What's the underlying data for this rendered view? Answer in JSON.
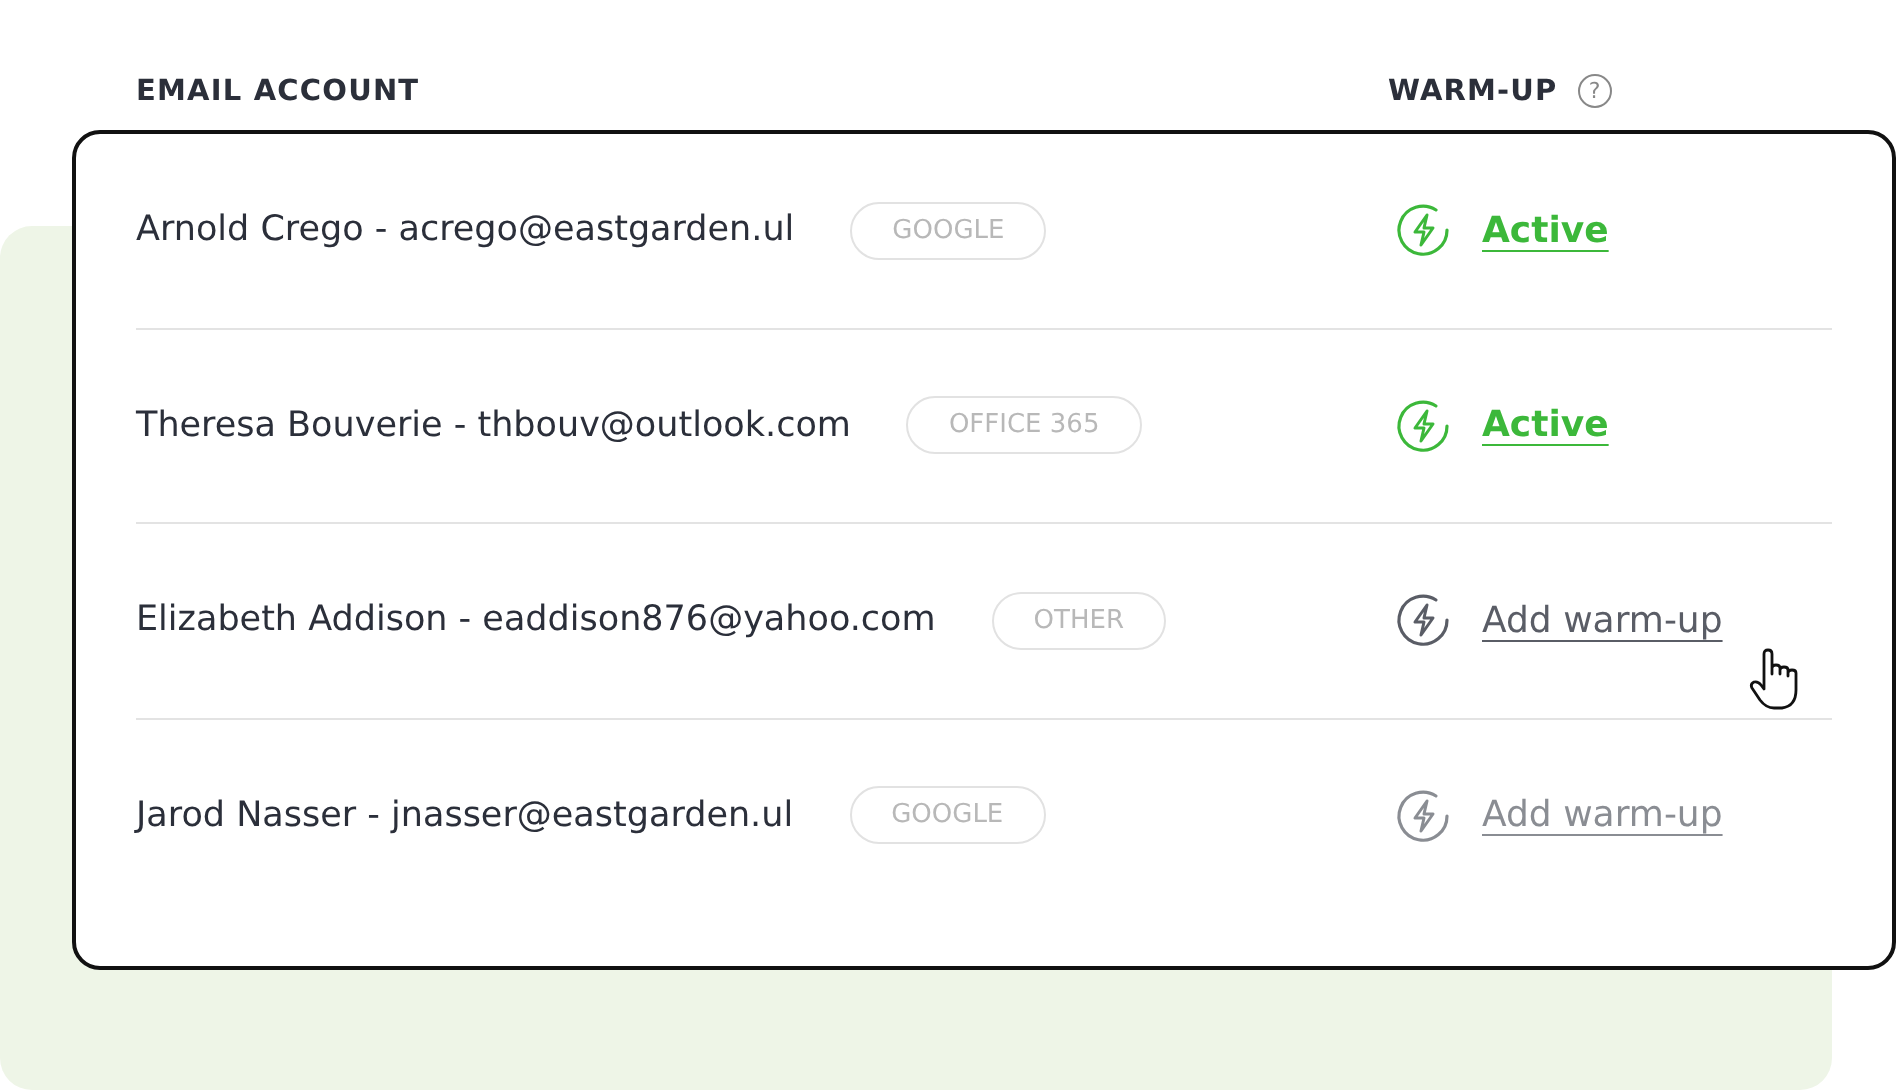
{
  "header": {
    "account_label": "EMAIL ACCOUNT",
    "warmup_label": "WARM-UP",
    "help_icon": "?"
  },
  "rows": [
    {
      "account": "Arnold Crego - acrego@eastgarden.ul",
      "provider": "GOOGLE",
      "warmup": {
        "kind": "active",
        "label": "Active"
      },
      "hovered": false
    },
    {
      "account": "Theresa Bouverie - thbouv@outlook.com",
      "provider": "OFFICE 365",
      "warmup": {
        "kind": "active",
        "label": "Active"
      },
      "hovered": false
    },
    {
      "account": "Elizabeth Addison - eaddison876@yahoo.com",
      "provider": "OTHER",
      "warmup": {
        "kind": "add",
        "label": "Add warm-up"
      },
      "hovered": true
    },
    {
      "account": "Jarod Nasser - jnasser@eastgarden.ul",
      "provider": "GOOGLE",
      "warmup": {
        "kind": "add",
        "label": "Add warm-up"
      },
      "hovered": false
    }
  ]
}
